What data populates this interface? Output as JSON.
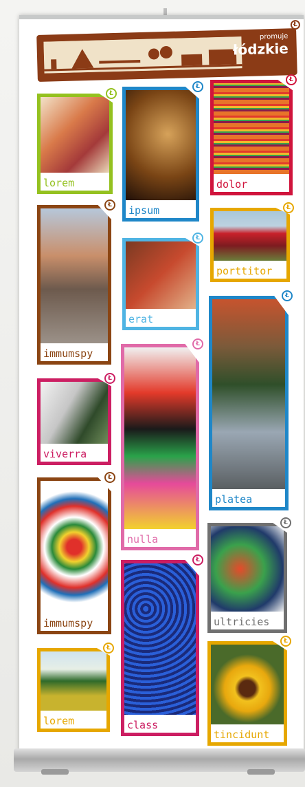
{
  "header": {
    "brand_small": "promuje",
    "brand_name": "łódzkie",
    "icon": "skyline-illustration",
    "color": "#8b3b16"
  },
  "badge_glyph": "Ł",
  "tiles": [
    {
      "label": "lorem",
      "color": "#94c11f",
      "photo": "scientist-molecule"
    },
    {
      "label": "ipsum",
      "color": "#1f87c8",
      "photo": "wooden-horse"
    },
    {
      "label": "dolor",
      "color": "#d0143c",
      "photo": "striped-fabric"
    },
    {
      "label": "immumspy",
      "color": "#8b4513",
      "photo": "town-square"
    },
    {
      "label": "erat",
      "color": "#4fb4e3",
      "photo": "restaurant-interior"
    },
    {
      "label": "porttitor",
      "color": "#e6a700",
      "photo": "red-train"
    },
    {
      "label": "viverra",
      "color": "#cc1e62",
      "photo": "modern-building"
    },
    {
      "label": "nulla",
      "color": "#e06aa8",
      "photo": "folk-costume"
    },
    {
      "label": "platea",
      "color": "#1f87c8",
      "photo": "city-aerial"
    },
    {
      "label": "immumspy",
      "color": "#8b4513",
      "photo": "folk-paper-cutout"
    },
    {
      "label": "ultricies",
      "color": "#707070",
      "photo": "embroidery"
    },
    {
      "label": "lorem",
      "color": "#e6a700",
      "photo": "green-field"
    },
    {
      "label": "class",
      "color": "#cc1e62",
      "photo": "blue-beadwork"
    },
    {
      "label": "tincidunt",
      "color": "#e6a700",
      "photo": "sunflowers"
    }
  ]
}
